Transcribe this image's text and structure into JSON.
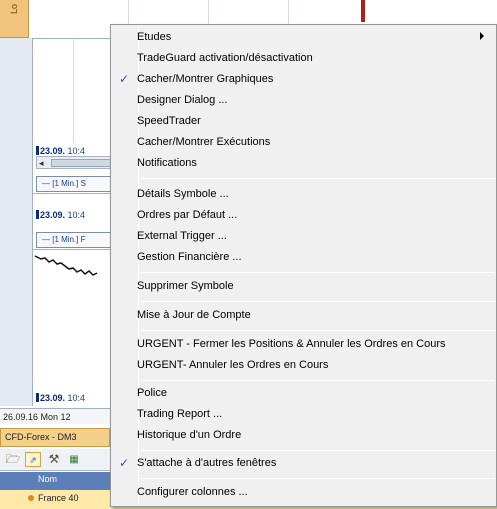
{
  "background": {
    "left_tab_label": "Lo",
    "time_labels": [
      {
        "date": "23.09.",
        "time": "10:4"
      },
      {
        "date": "23.09.",
        "time": "10:4"
      },
      {
        "date": "23.09.",
        "time": "10:4"
      }
    ],
    "series_labels": [
      "— [1 Min.] S",
      "— [1 Min.] F"
    ],
    "status_date": "26.09.16 Mon 12",
    "group_tab": "CFD-Forex - DM3",
    "column_header": "Nom",
    "row_label": "France 40"
  },
  "menu": {
    "items": [
      {
        "label": "Etudes",
        "checked": false,
        "submenu": true
      },
      {
        "label": "TradeGuard activation/désactivation",
        "checked": false
      },
      {
        "label": "Cacher/Montrer Graphiques",
        "checked": true
      },
      {
        "label": "Designer Dialog ...",
        "checked": false
      },
      {
        "label": "SpeedTrader",
        "checked": false
      },
      {
        "label": "Cacher/Montrer Exécutions",
        "checked": false
      },
      {
        "label": "Notifications",
        "checked": false
      },
      {
        "label": "Détails Symbole ...",
        "checked": false
      },
      {
        "label": "Ordres par Défaut ...",
        "checked": false
      },
      {
        "label": "External Trigger ...",
        "checked": false
      },
      {
        "label": "Gestion Financière ...",
        "checked": false
      },
      {
        "label": "Supprimer Symbole",
        "checked": false
      },
      {
        "label": "Mise à Jour de Compte",
        "checked": false
      },
      {
        "label": "URGENT - Fermer les Positions & Annuler les Ordres en Cours",
        "checked": false
      },
      {
        "label": "URGENT- Annuler les Ordres en Cours",
        "checked": false
      },
      {
        "label": "Police",
        "checked": false
      },
      {
        "label": "Trading Report ...",
        "checked": false
      },
      {
        "label": "Historique d'un Ordre",
        "checked": false
      },
      {
        "label": "S'attache à d'autres fenêtres",
        "checked": true
      },
      {
        "label": "Configurer colonnes ...",
        "checked": false
      }
    ],
    "check_glyph": "✓"
  }
}
